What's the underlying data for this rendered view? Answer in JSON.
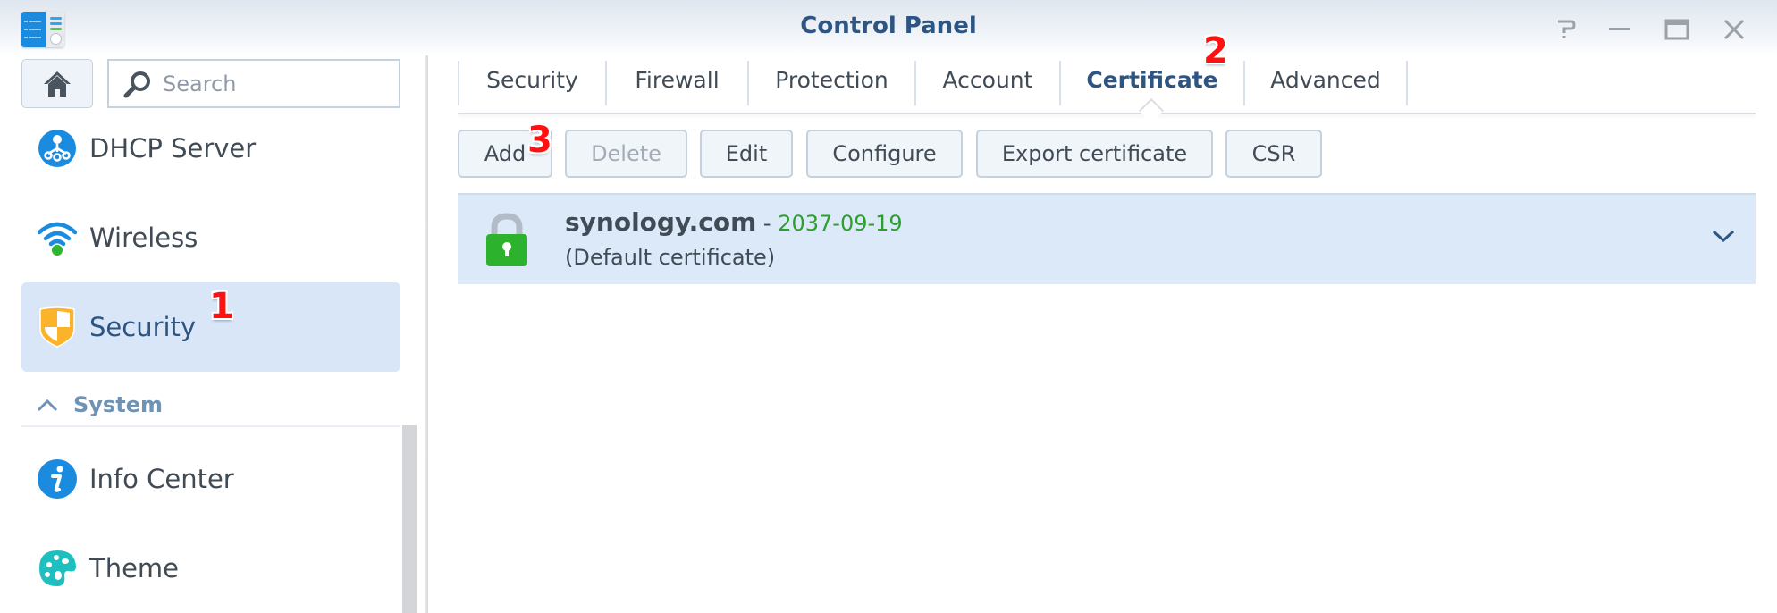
{
  "window": {
    "title": "Control Panel",
    "app_icon": "control-panel-icon",
    "controls": [
      "help-icon",
      "minimize-icon",
      "maximize-icon",
      "close-icon"
    ]
  },
  "sidebar": {
    "home_icon": "home-icon",
    "search": {
      "placeholder": "Search",
      "value": "",
      "icon": "search-icon"
    },
    "items": [
      {
        "label": "DHCP Server",
        "icon": "dhcp-server-icon",
        "active": false
      },
      {
        "label": "Wireless",
        "icon": "wireless-icon",
        "active": false
      },
      {
        "label": "Security",
        "icon": "security-shield-icon",
        "active": true
      }
    ],
    "section": {
      "label": "System",
      "icon": "chevron-up-icon",
      "expanded": true
    },
    "section_items": [
      {
        "label": "Info Center",
        "icon": "info-icon"
      },
      {
        "label": "Theme",
        "icon": "palette-icon"
      }
    ]
  },
  "tabs": [
    {
      "label": "Security",
      "active": false
    },
    {
      "label": "Firewall",
      "active": false
    },
    {
      "label": "Protection",
      "active": false
    },
    {
      "label": "Account",
      "active": false
    },
    {
      "label": "Certificate",
      "active": true
    },
    {
      "label": "Advanced",
      "active": false
    }
  ],
  "toolbar": {
    "add": "Add",
    "delete": "Delete",
    "edit": "Edit",
    "configure": "Configure",
    "export": "Export certificate",
    "csr": "CSR"
  },
  "certificates": [
    {
      "name": "synology.com",
      "separator": " - ",
      "expiry": "2037-09-19",
      "note": "(Default certificate)",
      "icon": "lock-icon",
      "selected": true
    }
  ],
  "annotations": {
    "step1": "1",
    "step2": "2",
    "step3": "3"
  },
  "colors": {
    "accent": "#2d5584",
    "selection": "#d8e6f8",
    "expiry_green": "#2ca02c",
    "annotation_red": "#ff1111"
  }
}
